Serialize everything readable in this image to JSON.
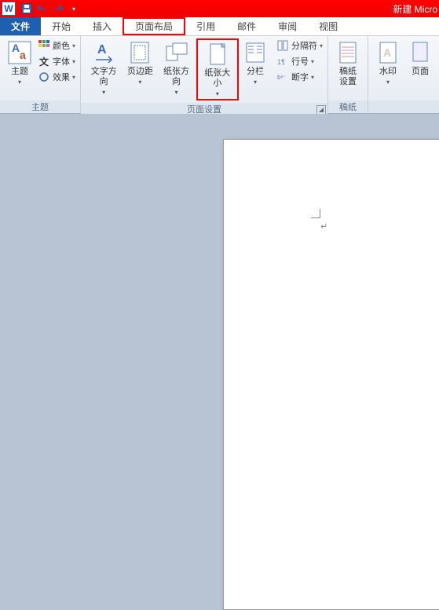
{
  "title": "新建 Micro",
  "qat": {
    "save": "保存",
    "undo": "撤销",
    "redo": "重做"
  },
  "tabs": {
    "file": "文件",
    "home": "开始",
    "insert": "插入",
    "layout": "页面布局",
    "references": "引用",
    "mail": "邮件",
    "review": "审阅",
    "view": "视图"
  },
  "groups": {
    "theme": {
      "label": "主题",
      "theme_btn": "主题",
      "colors": "颜色",
      "fonts": "字体",
      "effects": "效果"
    },
    "page_setup": {
      "label": "页面设置",
      "text_dir": "文字方向",
      "margins": "页边距",
      "orientation": "纸张方向",
      "size": "纸张大小",
      "columns": "分栏",
      "breaks": "分隔符",
      "line_num": "行号",
      "hyphen": "断字"
    },
    "stationery": {
      "label": "稿纸",
      "settings": "稿纸\n设置"
    },
    "bg": {
      "watermark": "水印",
      "page_color": "页面"
    }
  }
}
